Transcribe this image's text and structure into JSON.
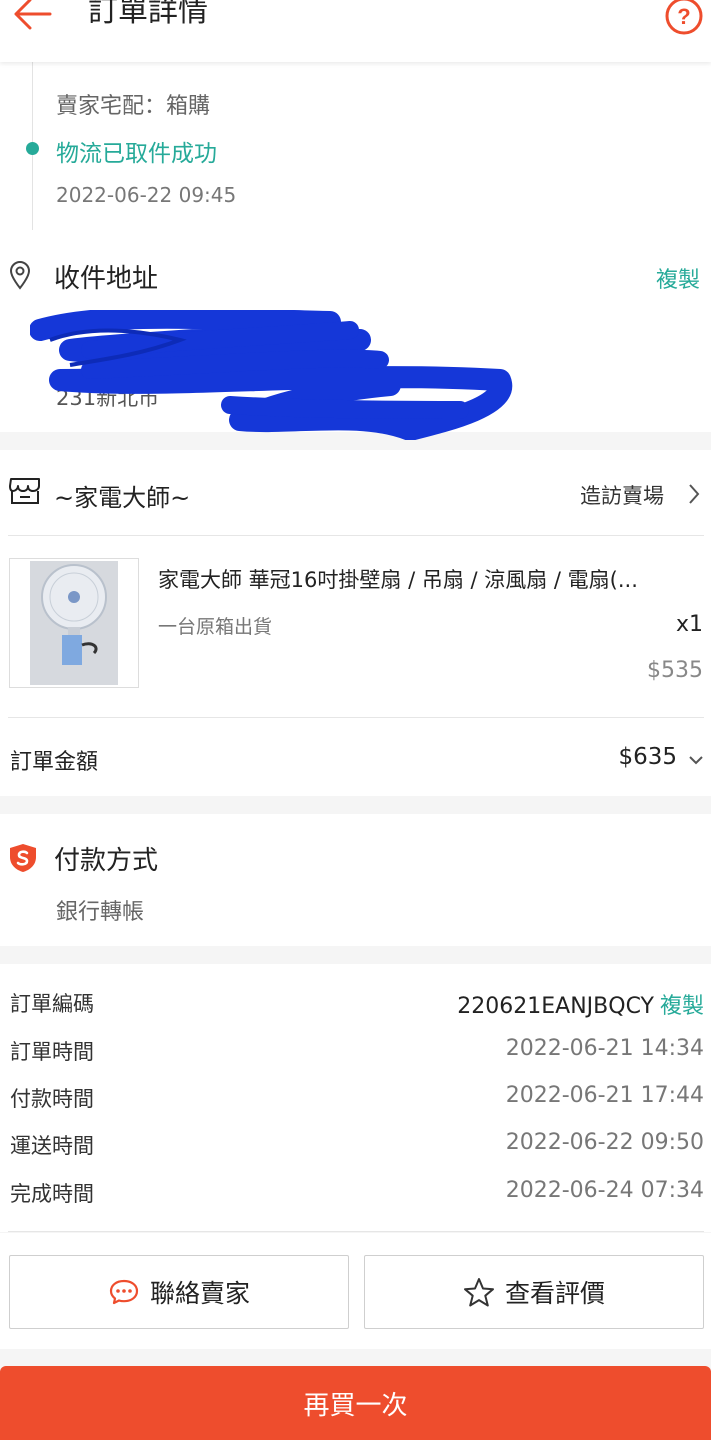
{
  "header": {
    "title": "訂單詳情"
  },
  "tracking": {
    "method": "賣家宅配：箱購",
    "status": "物流已取件成功",
    "time": "2022-06-22 09:45"
  },
  "address": {
    "title": "收件地址",
    "copy_label": "複製",
    "line1": "",
    "line2": "231新北市"
  },
  "shop": {
    "name": "~家電大師~",
    "visit_label": "造訪賣場"
  },
  "product": {
    "name": "家電大師 華冠16吋掛壁扇 / 吊扇 / 涼風扇 / 電扇(...",
    "variant": "一台原箱出貨",
    "quantity": "x1",
    "price": "$535"
  },
  "order_total": {
    "label": "訂單金額",
    "value": "$635"
  },
  "payment": {
    "title": "付款方式",
    "method": "銀行轉帳"
  },
  "order_info": {
    "order_no_label": "訂單編碼",
    "order_no": "220621EANJBQCY",
    "copy_label": "複製",
    "rows": [
      {
        "label": "訂單時間",
        "value": "2022-06-21 14:34"
      },
      {
        "label": "付款時間",
        "value": "2022-06-21 17:44"
      },
      {
        "label": "運送時間",
        "value": "2022-06-22 09:50"
      },
      {
        "label": "完成時間",
        "value": "2022-06-24 07:34"
      }
    ]
  },
  "actions": {
    "contact_label": "聯絡賣家",
    "review_label": "查看評價",
    "buy_again_label": "再買一次"
  },
  "colors": {
    "accent": "#ee4d2d",
    "teal": "#26aa99",
    "redact": "#1537d8"
  }
}
